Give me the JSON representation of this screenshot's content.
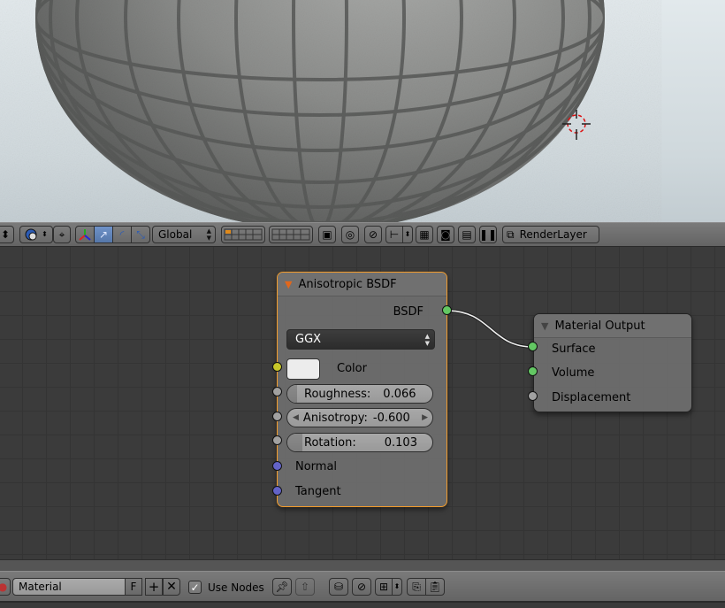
{
  "viewport_header": {
    "orientation_label": "Global",
    "render_layer_label": "RenderLayer"
  },
  "nodes": {
    "anisotropic": {
      "title": "Anisotropic BSDF",
      "output_label": "BSDF",
      "distribution": "GGX",
      "color_label": "Color",
      "color_value": "#ececec",
      "roughness_label": "Roughness:",
      "roughness_value": "0.066",
      "roughness_fraction": 0.066,
      "anisotropy_label": "Anisotropy:",
      "anisotropy_value": "-0.600",
      "rotation_label": "Rotation:",
      "rotation_value": "0.103",
      "rotation_fraction": 0.103,
      "normal_label": "Normal",
      "tangent_label": "Tangent"
    },
    "output": {
      "title": "Material Output",
      "surface_label": "Surface",
      "volume_label": "Volume",
      "displacement_label": "Displacement"
    }
  },
  "node_header": {
    "material_name": "Material",
    "fake_user_label": "F",
    "use_nodes_label": "Use Nodes",
    "use_nodes_checked": true
  },
  "colors": {
    "selected_outline": "#f39c2b",
    "socket_shader": "#63c763",
    "socket_color": "#c7c729",
    "socket_value": "#a1a1a1",
    "socket_vector": "#6363c7",
    "active_button": "#5577aa"
  }
}
